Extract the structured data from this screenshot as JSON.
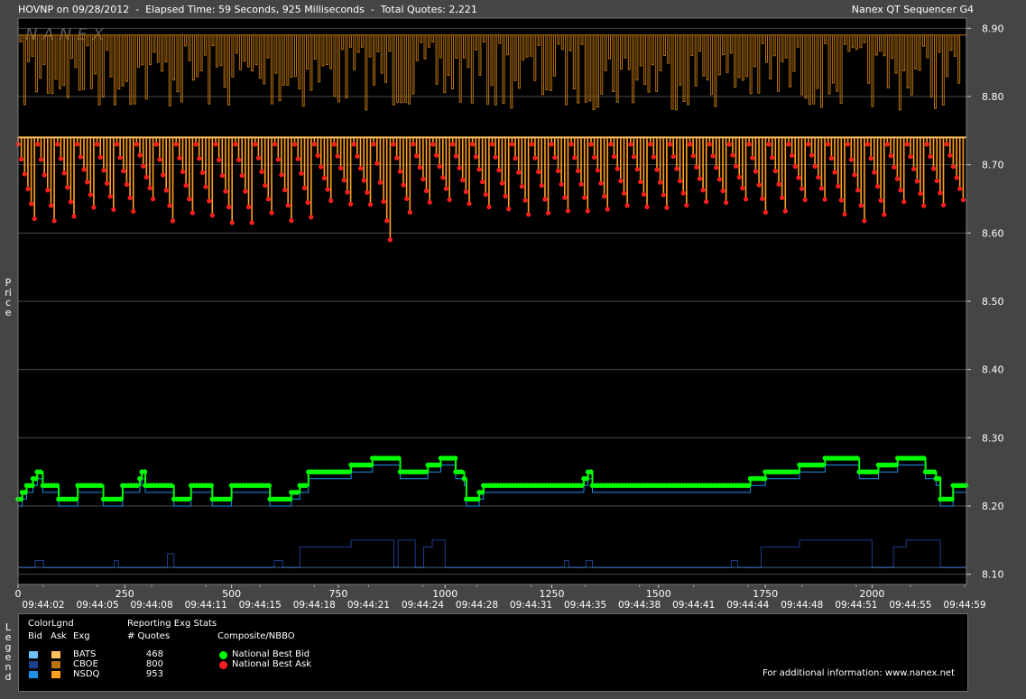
{
  "header": {
    "title": "HOVNP on 09/28/2012  -  Elapsed Time: 59 Seconds, 925 Milliseconds  -  Total Quotes: 2,221",
    "app_name": "Nanex QT Sequencer G4"
  },
  "watermark": "NANEX",
  "side_labels": {
    "price": "Price",
    "legend": "Legend"
  },
  "colors": {
    "plot_bg": "#000000",
    "page_bg": "#454545",
    "grid": "#4a4a4a",
    "national_best_bid": "#00ff00",
    "national_best_ask": "#ff1e1e",
    "bats_bid": "#6cc4ff",
    "cboe_bid": "#1c3f8f",
    "nsdq_bid": "#1e90e8",
    "bats_ask": "#ffc060",
    "cboe_ask": "#b8720e",
    "nsdq_ask": "#ffa020"
  },
  "chart_data": {
    "type": "line",
    "ylabel": "Price",
    "ylim": [
      8.085,
      8.915
    ],
    "y_ticks": [
      "8.90",
      "8.80",
      "8.70",
      "8.60",
      "8.50",
      "8.40",
      "8.30",
      "8.20",
      "8.10"
    ],
    "xlim": [
      0,
      2221
    ],
    "x_ticks": [
      "0",
      "250",
      "500",
      "750",
      "1000",
      "1250",
      "1500",
      "1750",
      "2000"
    ],
    "x_tick_values": [
      0,
      250,
      500,
      750,
      1000,
      1250,
      1500,
      1750,
      2000
    ],
    "time_labels": [
      "09:44:02",
      "09:44:05",
      "09:44:08",
      "09:44:11",
      "09:44:15",
      "09:44:18",
      "09:44:21",
      "09:44:24",
      "09:44:28",
      "09:44:31",
      "09:44:35",
      "09:44:38",
      "09:44:41",
      "09:44:44",
      "09:44:48",
      "09:44:51",
      "09:44:55",
      "09:44:59"
    ],
    "series": [
      {
        "name": "National Best Bid",
        "steps": [
          [
            0,
            8.21
          ],
          [
            10,
            8.22
          ],
          [
            20,
            8.23
          ],
          [
            35,
            8.24
          ],
          [
            45,
            8.25
          ],
          [
            58,
            8.23
          ],
          [
            95,
            8.21
          ],
          [
            140,
            8.23
          ],
          [
            200,
            8.21
          ],
          [
            245,
            8.23
          ],
          [
            285,
            8.24
          ],
          [
            290,
            8.25
          ],
          [
            298,
            8.23
          ],
          [
            365,
            8.21
          ],
          [
            405,
            8.23
          ],
          [
            455,
            8.21
          ],
          [
            500,
            8.23
          ],
          [
            590,
            8.21
          ],
          [
            640,
            8.22
          ],
          [
            660,
            8.23
          ],
          [
            680,
            8.25
          ],
          [
            780,
            8.26
          ],
          [
            830,
            8.27
          ],
          [
            895,
            8.25
          ],
          [
            960,
            8.26
          ],
          [
            990,
            8.27
          ],
          [
            1025,
            8.25
          ],
          [
            1045,
            8.24
          ],
          [
            1050,
            8.21
          ],
          [
            1080,
            8.22
          ],
          [
            1090,
            8.23
          ],
          [
            1325,
            8.24
          ],
          [
            1335,
            8.25
          ],
          [
            1345,
            8.23
          ],
          [
            1715,
            8.24
          ],
          [
            1750,
            8.25
          ],
          [
            1830,
            8.26
          ],
          [
            1890,
            8.27
          ],
          [
            1970,
            8.25
          ],
          [
            2015,
            8.26
          ],
          [
            2060,
            8.27
          ],
          [
            2125,
            8.25
          ],
          [
            2150,
            8.24
          ],
          [
            2160,
            8.21
          ],
          [
            2190,
            8.23
          ],
          [
            2220,
            8.23
          ]
        ]
      },
      {
        "name": "National Best Ask",
        "zigzag_range": [
          8.62,
          8.73
        ],
        "min": 8.59
      }
    ],
    "legend": {
      "color_legend_title": "ColorLgnd",
      "stats_title": "Reporting Exg Stats",
      "composite_title": "Composite/NBBO",
      "col_headers": [
        "Bid",
        "Ask",
        "Exg"
      ],
      "quotes_header": "# Quotes",
      "exchanges": [
        {
          "name": "BATS",
          "quotes": "468"
        },
        {
          "name": "CBOE",
          "quotes": "800"
        },
        {
          "name": "NSDQ",
          "quotes": "953"
        }
      ],
      "composite_items": [
        "National Best Bid",
        "National Best Ask"
      ]
    }
  },
  "footer": {
    "info": "For additional information: www.nanex.net"
  }
}
